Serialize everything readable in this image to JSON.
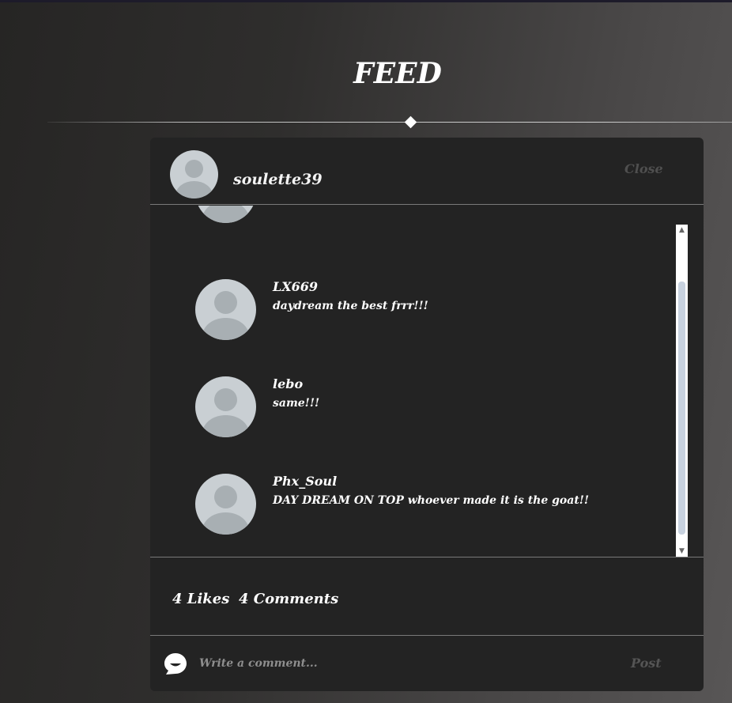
{
  "page": {
    "title": "FEED"
  },
  "post_modal": {
    "author": "soulette39",
    "close_label": "Close",
    "comments": [
      {
        "user": "LX669",
        "text": "daydream the best frrr!!!"
      },
      {
        "user": "lebo",
        "text": "same!!!"
      },
      {
        "user": "Phx_Soul",
        "text": "DAY DREAM ON TOP whoever made it is the goat!!"
      }
    ],
    "stats": {
      "likes_label": "4 Likes",
      "comments_label": "4 Comments"
    },
    "comment_form": {
      "placeholder": "Write a comment...",
      "value": "",
      "post_label": "Post"
    }
  },
  "icons": {
    "avatar": "default-user-avatar",
    "comment": "smile-speech-bubble-icon",
    "scroll_up": "chevron-up-icon",
    "scroll_down": "chevron-down-icon"
  },
  "colors": {
    "modal_bg": "#232323",
    "avatar_bg": "#c9cfd3",
    "avatar_fg": "#a8afb3",
    "muted_button": "#555555",
    "scroll_thumb": "#c8d2df"
  }
}
